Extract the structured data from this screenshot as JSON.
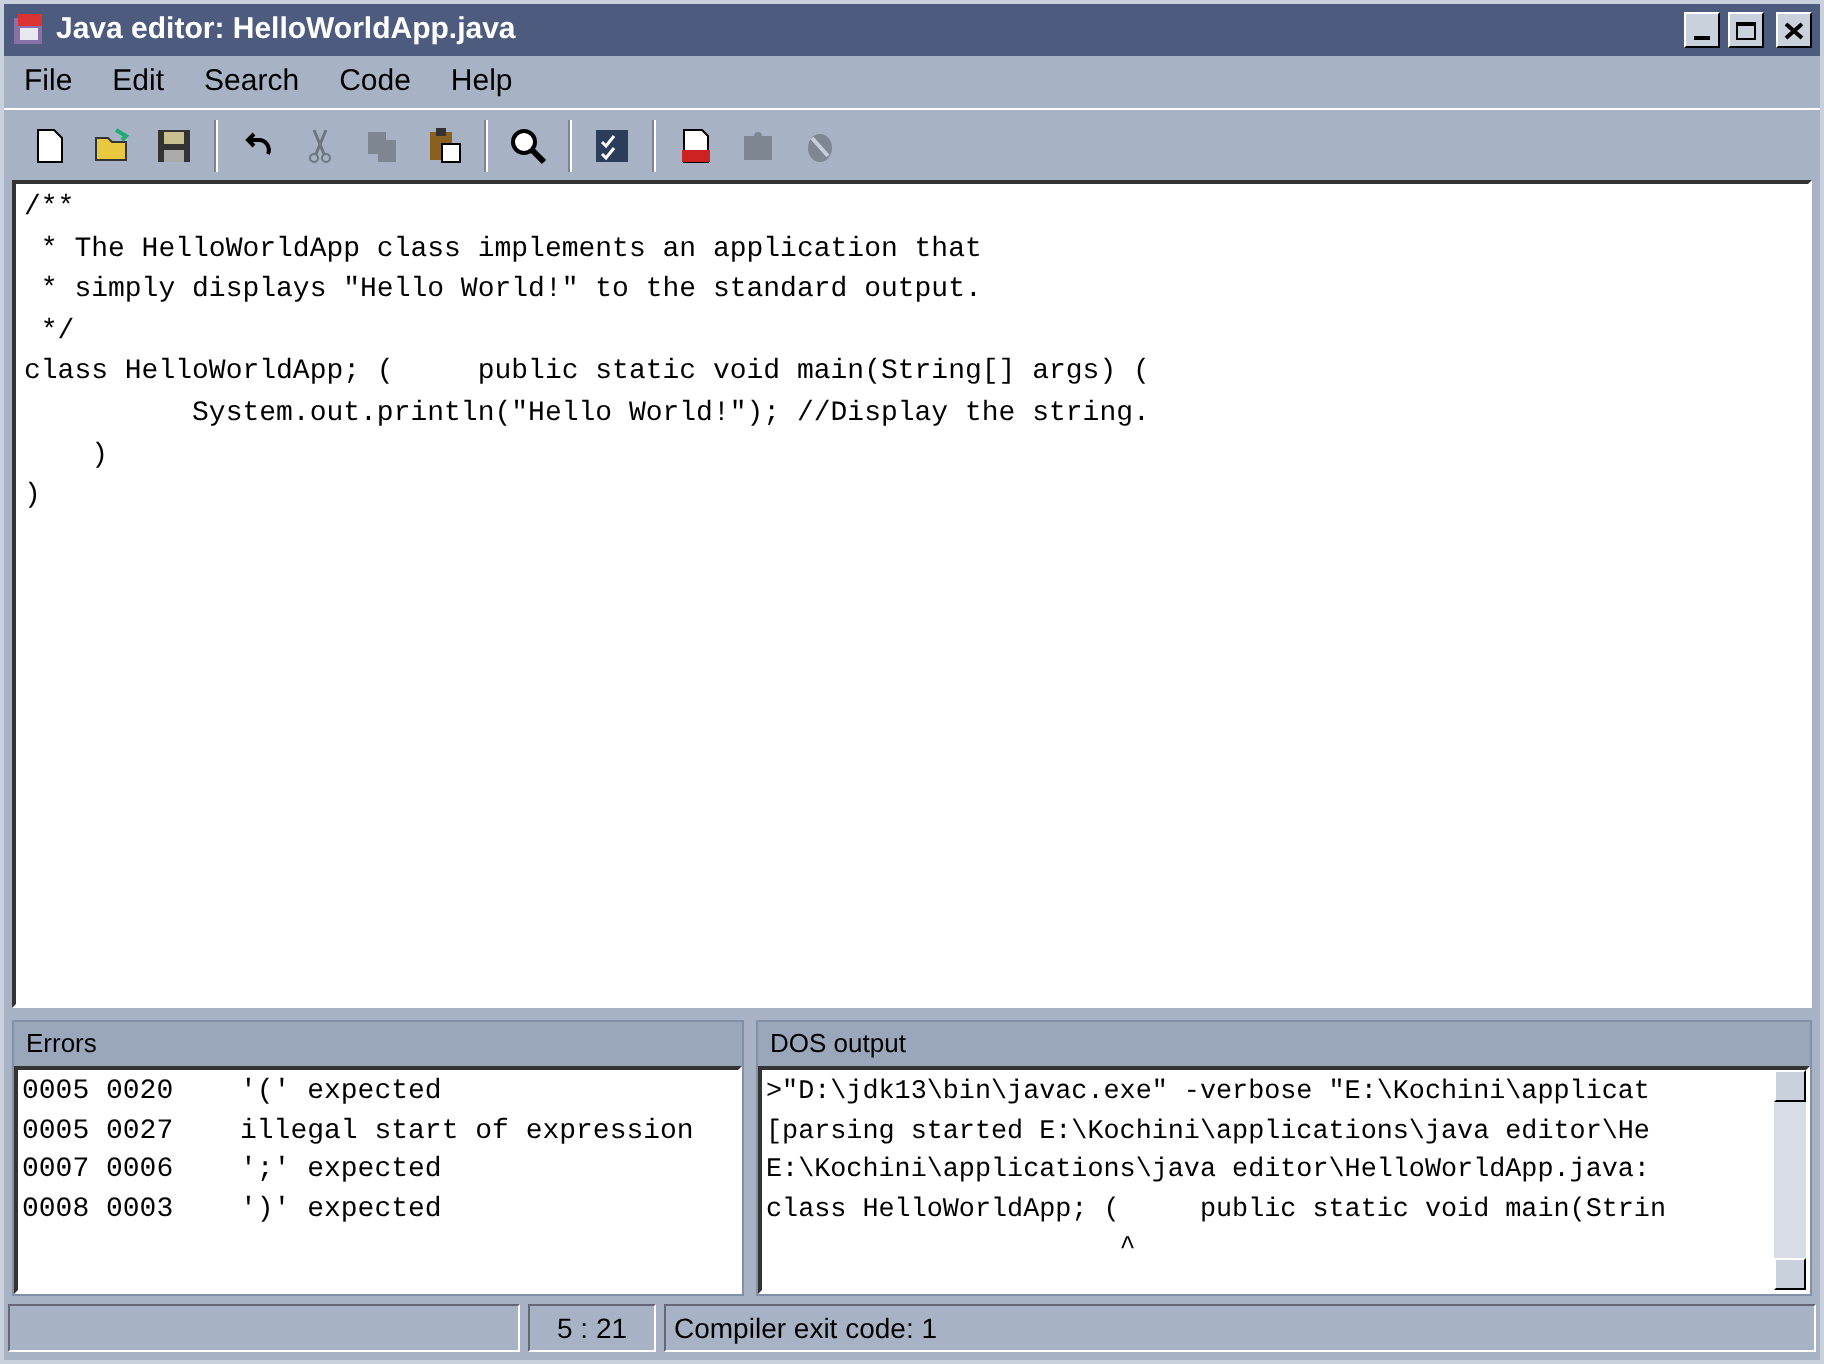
{
  "window": {
    "title": "Java editor: HelloWorldApp.java"
  },
  "menu": [
    {
      "label": "File"
    },
    {
      "label": "Edit"
    },
    {
      "label": "Search"
    },
    {
      "label": "Code"
    },
    {
      "label": "Help"
    }
  ],
  "toolbar": [
    {
      "kind": "new",
      "disabled": false
    },
    {
      "kind": "open",
      "disabled": false
    },
    {
      "kind": "save",
      "disabled": false
    },
    {
      "kind": "separator"
    },
    {
      "kind": "undo",
      "disabled": false
    },
    {
      "kind": "cut",
      "disabled": true
    },
    {
      "kind": "copy",
      "disabled": true
    },
    {
      "kind": "paste",
      "disabled": false
    },
    {
      "kind": "separator"
    },
    {
      "kind": "find",
      "disabled": false
    },
    {
      "kind": "separator"
    },
    {
      "kind": "check",
      "disabled": false
    },
    {
      "kind": "separator"
    },
    {
      "kind": "compile",
      "disabled": false
    },
    {
      "kind": "run",
      "disabled": true
    },
    {
      "kind": "debug",
      "disabled": true
    }
  ],
  "editor": {
    "lines": [
      "/**",
      " * The HelloWorldApp class implements an application that",
      " * simply displays \"Hello World!\" to the standard output.",
      " */",
      "class HelloWorldApp; (     public static void main(String[] args) (",
      "          System.out.println(\"Hello World!\"); //Display the string.",
      "    )",
      ")"
    ]
  },
  "errors_panel": {
    "title": "Errors",
    "rows": [
      {
        "line": "0005",
        "column": "0020",
        "message": "'(' expected"
      },
      {
        "line": "0005",
        "column": "0027",
        "message": "illegal start of expression"
      },
      {
        "line": "0007",
        "column": "0006",
        "message": "';' expected"
      },
      {
        "line": "0008",
        "column": "0003",
        "message": "')' expected"
      }
    ]
  },
  "output_panel": {
    "title": "DOS output",
    "lines": [
      ">\"D:\\jdk13\\bin\\javac.exe\" -verbose \"E:\\Kochini\\applicat",
      "[parsing started E:\\Kochini\\applications\\java editor\\He",
      "E:\\Kochini\\applications\\java editor\\HelloWorldApp.java:",
      "class HelloWorldApp; (     public static void main(Strin",
      "                      ^"
    ]
  },
  "status_bar": {
    "position": "5 : 21",
    "message": "Compiler exit code: 1"
  }
}
